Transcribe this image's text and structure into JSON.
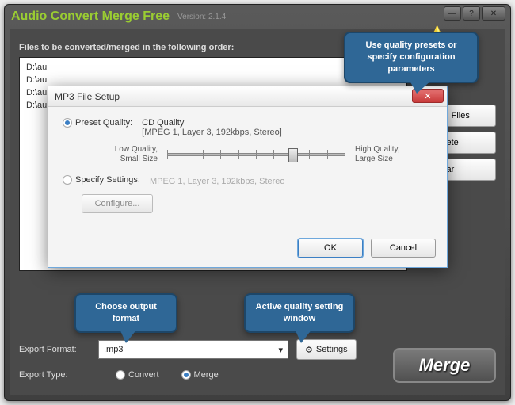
{
  "app": {
    "title": "Audio Convert Merge Free",
    "version_label": "Version: 2.1.4"
  },
  "section_label": "Files to be converted/merged in the following order:",
  "files": [
    "D:\\au",
    "D:\\au",
    "D:\\au",
    "D:\\au"
  ],
  "side_buttons": {
    "add": "Add Files",
    "delete": "Delete",
    "clear": "Clear"
  },
  "export": {
    "format_label": "Export Format:",
    "format_value": ".mp3",
    "settings_label": "Settings",
    "type_label": "Export Type:",
    "convert_label": "Convert",
    "merge_label": "Merge",
    "merge_button": "Merge"
  },
  "modal": {
    "title": "MP3 File Setup",
    "preset_label": "Preset Quality:",
    "preset_name": "CD Quality",
    "preset_desc": "[MPEG 1, Layer 3, 192kbps, Stereo]",
    "low_label": "Low Quality,\nSmall Size",
    "high_label": "High Quality,\nLarge Size",
    "specify_label": "Specify Settings:",
    "specify_hint": "MPEG 1, Layer 3, 192kbps, Stereo",
    "configure": "Configure...",
    "ok": "OK",
    "cancel": "Cancel"
  },
  "callouts": {
    "presets": "Use quality presets or specify configuration parameters",
    "format": "Choose output format",
    "settings": "Active quality setting window"
  }
}
